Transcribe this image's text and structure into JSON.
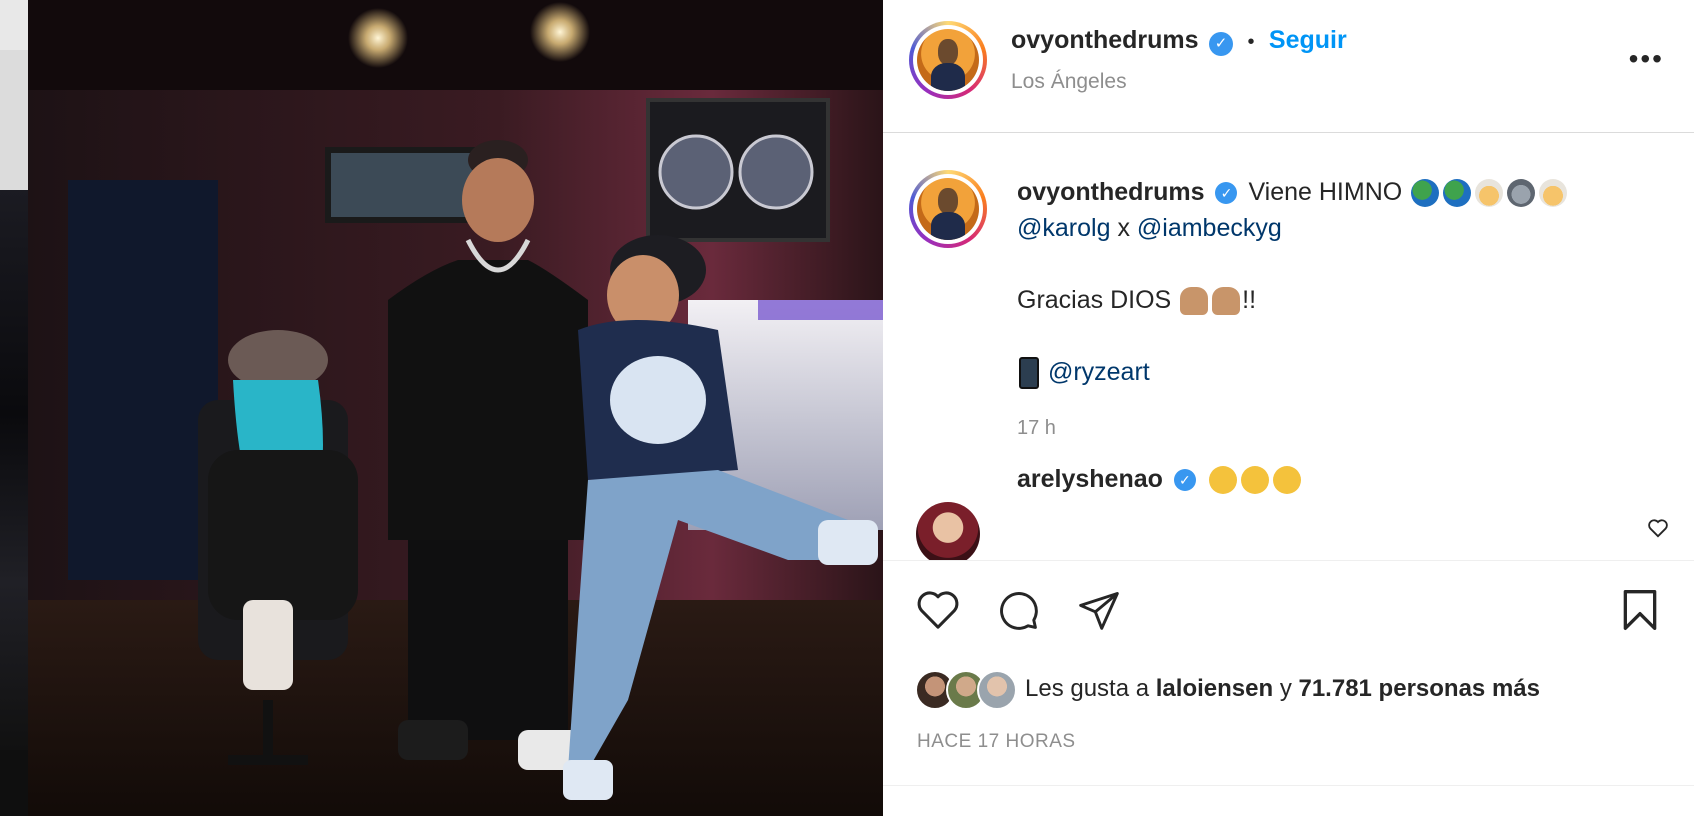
{
  "post": {
    "author": "ovyonthedrums",
    "verified_mark": "✓",
    "separator": "•",
    "follow_label": "Seguir",
    "location": "Los Ángeles",
    "more_label": "•••"
  },
  "caption": {
    "author": "ovyonthedrums",
    "line1": "Viene HIMNO",
    "line1_emojis": [
      "globe-americas",
      "globe-americas",
      "older-woman",
      "koala",
      "older-woman"
    ],
    "mention1": "@karolg",
    "joiner": "x",
    "mention2": "@iambeckyg",
    "line2": "Gracias DIOS",
    "line2_emojis": [
      "folded-hands",
      "folded-hands"
    ],
    "line2_suffix": "!!",
    "line3_emoji": "mobile-phone",
    "mention3": "@ryzeart",
    "time": "17 h"
  },
  "comment": {
    "author": "arelyshenao",
    "emojis": [
      "clapping-hands",
      "clapping-hands",
      "clapping-hands"
    ]
  },
  "actions": {
    "icons": [
      "heart-icon",
      "comment-icon",
      "share-icon",
      "bookmark-icon"
    ]
  },
  "likes": {
    "prefix": "Les gusta a",
    "user": "laloiensen",
    "conj": "y",
    "count_text": "71.781 personas más"
  },
  "timestamp": "HACE 17 HORAS",
  "colors": {
    "link": "#00376b",
    "follow": "#0095f6",
    "verified": "#3897f0",
    "muted": "#8e8e8e"
  }
}
